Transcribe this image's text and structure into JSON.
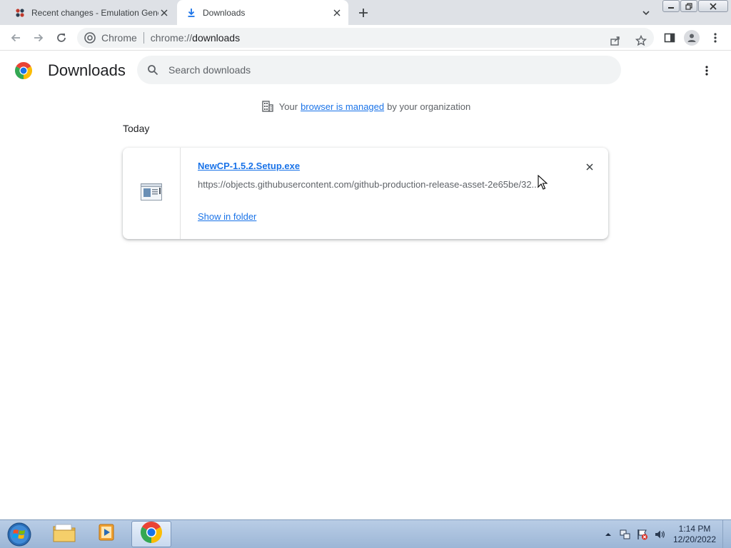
{
  "tabs": [
    {
      "title": "Recent changes - Emulation General",
      "favicon": "wiki-icon",
      "active": false
    },
    {
      "title": "Downloads",
      "favicon": "download-icon",
      "active": true
    }
  ],
  "toolbar": {
    "site_chip": "Chrome",
    "url_scheme": "chrome://",
    "url_host": "downloads"
  },
  "page": {
    "title": "Downloads",
    "search_placeholder": "Search downloads"
  },
  "managed_notice": {
    "prefix": "Your",
    "link": "browser is managed",
    "suffix": "by your organization"
  },
  "downloads": {
    "date_heading": "Today",
    "items": [
      {
        "file_name": "NewCP-1.5.2.Setup.exe",
        "url": "https://objects.githubusercontent.com/github-production-release-asset-2e65be/32...",
        "action": "Show in folder"
      }
    ]
  },
  "taskbar": {
    "time": "1:14 PM",
    "date": "12/20/2022"
  },
  "colors": {
    "link": "#1a73e8",
    "tab_strip": "#dee1e6",
    "omnibox": "#f1f3f4"
  }
}
